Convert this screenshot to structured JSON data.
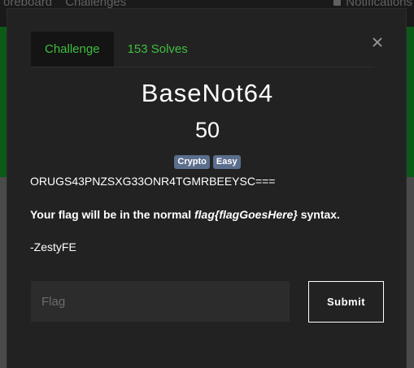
{
  "background_nav": {
    "items": [
      "oreboard",
      "Challenges"
    ],
    "notifications_label": "Notifications"
  },
  "modal": {
    "tabs": [
      {
        "label": "Challenge",
        "active": true
      },
      {
        "label": "153 Solves",
        "active": false
      }
    ],
    "title": "BaseNot64",
    "points": "50",
    "tags": [
      "Crypto",
      "Easy"
    ],
    "description": {
      "line1": "ORUGS43PNZSXG33ONR4TGMRBEEYSC===",
      "line2_prefix": "Your flag will be in the normal ",
      "line2_italic": "flag{flagGoesHere}",
      "line2_suffix": " syntax.",
      "line3": "-ZestyFE"
    },
    "flag_input": {
      "value": "",
      "placeholder": "Flag"
    },
    "submit_label": "Submit",
    "close_icon": "close-icon"
  },
  "colors": {
    "tab_text": "#3fbf3f",
    "tag_bg": "#5b6e8c",
    "modal_bg": "#222222",
    "input_bg": "#2c2c2c",
    "bg_green": "#0b5a17"
  }
}
